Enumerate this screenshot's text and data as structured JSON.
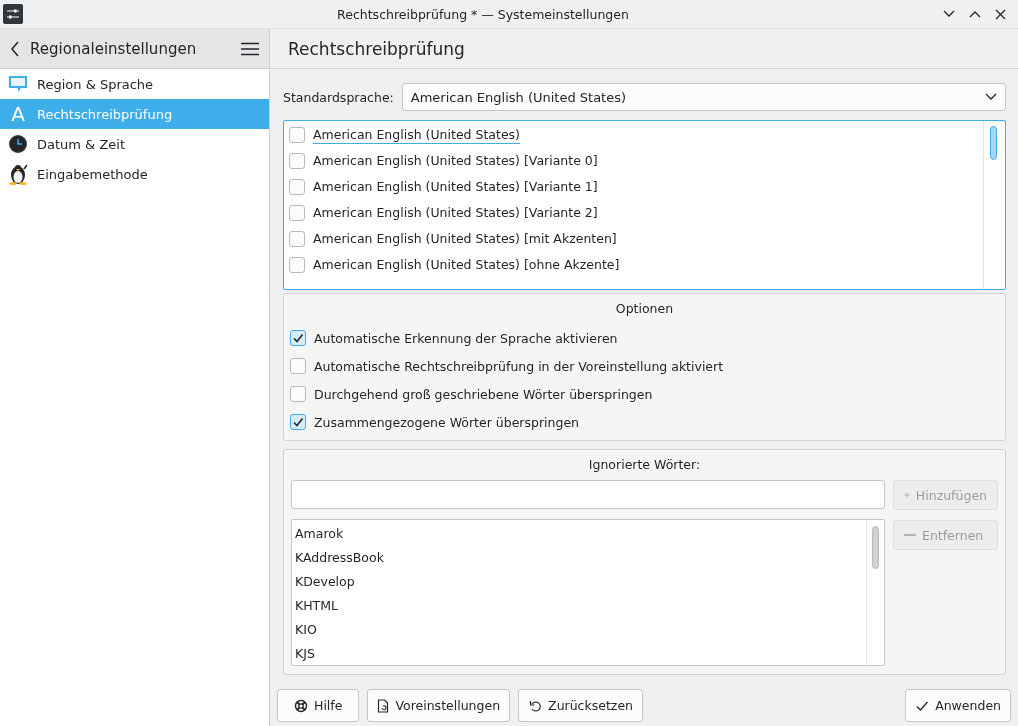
{
  "window": {
    "title": "Rechtschreibprüfung * — Systemeinstellungen"
  },
  "sidebar": {
    "title": "Regionaleinstellungen",
    "items": [
      {
        "label": "Region & Sprache",
        "kind": "bubble",
        "selected": false
      },
      {
        "label": "Rechtschreibprüfung",
        "kind": "letter",
        "icon_text": "A",
        "selected": true
      },
      {
        "label": "Datum & Zeit",
        "kind": "clock",
        "selected": false
      },
      {
        "label": "Eingabemethode",
        "kind": "penguin",
        "selected": false
      }
    ]
  },
  "page": {
    "title": "Rechtschreibprüfung"
  },
  "default_language": {
    "label": "Standardsprache:",
    "value": "American English (United States)"
  },
  "dictionaries": [
    {
      "label": "American English (United States)",
      "checked": false,
      "focused": true
    },
    {
      "label": "American English (United States) [Variante 0]",
      "checked": false,
      "focused": false
    },
    {
      "label": "American English (United States) [Variante 1]",
      "checked": false,
      "focused": false
    },
    {
      "label": "American English (United States) [Variante 2]",
      "checked": false,
      "focused": false
    },
    {
      "label": "American English (United States) [mit Akzenten]",
      "checked": false,
      "focused": false
    },
    {
      "label": "American English (United States) [ohne Akzente]",
      "checked": false,
      "focused": false
    }
  ],
  "options": {
    "title": "Optionen",
    "items": [
      {
        "label": "Automatische Erkennung der Sprache aktivieren",
        "checked": true
      },
      {
        "label": "Automatische Rechtschreibprüfung in der Voreinstellung aktiviert",
        "checked": false
      },
      {
        "label": "Durchgehend groß geschriebene Wörter überspringen",
        "checked": false
      },
      {
        "label": "Zusammengezogene Wörter überspringen",
        "checked": true
      }
    ]
  },
  "ignored_words": {
    "title": "Ignorierte Wörter:",
    "add_button": {
      "label": "Hinzufügen",
      "disabled": true
    },
    "remove_button": {
      "label": "Entfernen",
      "disabled": true
    },
    "words": [
      "Amarok",
      "KAddressBook",
      "KDevelop",
      "KHTML",
      "KIO",
      "KJS"
    ]
  },
  "buttons": [
    {
      "label": "Hilfe",
      "kind": "help"
    },
    {
      "label": "Voreinstellungen",
      "kind": "defaults"
    },
    {
      "label": "Zurücksetzen",
      "kind": "reset"
    },
    {
      "label": "Anwenden",
      "kind": "apply"
    }
  ]
}
